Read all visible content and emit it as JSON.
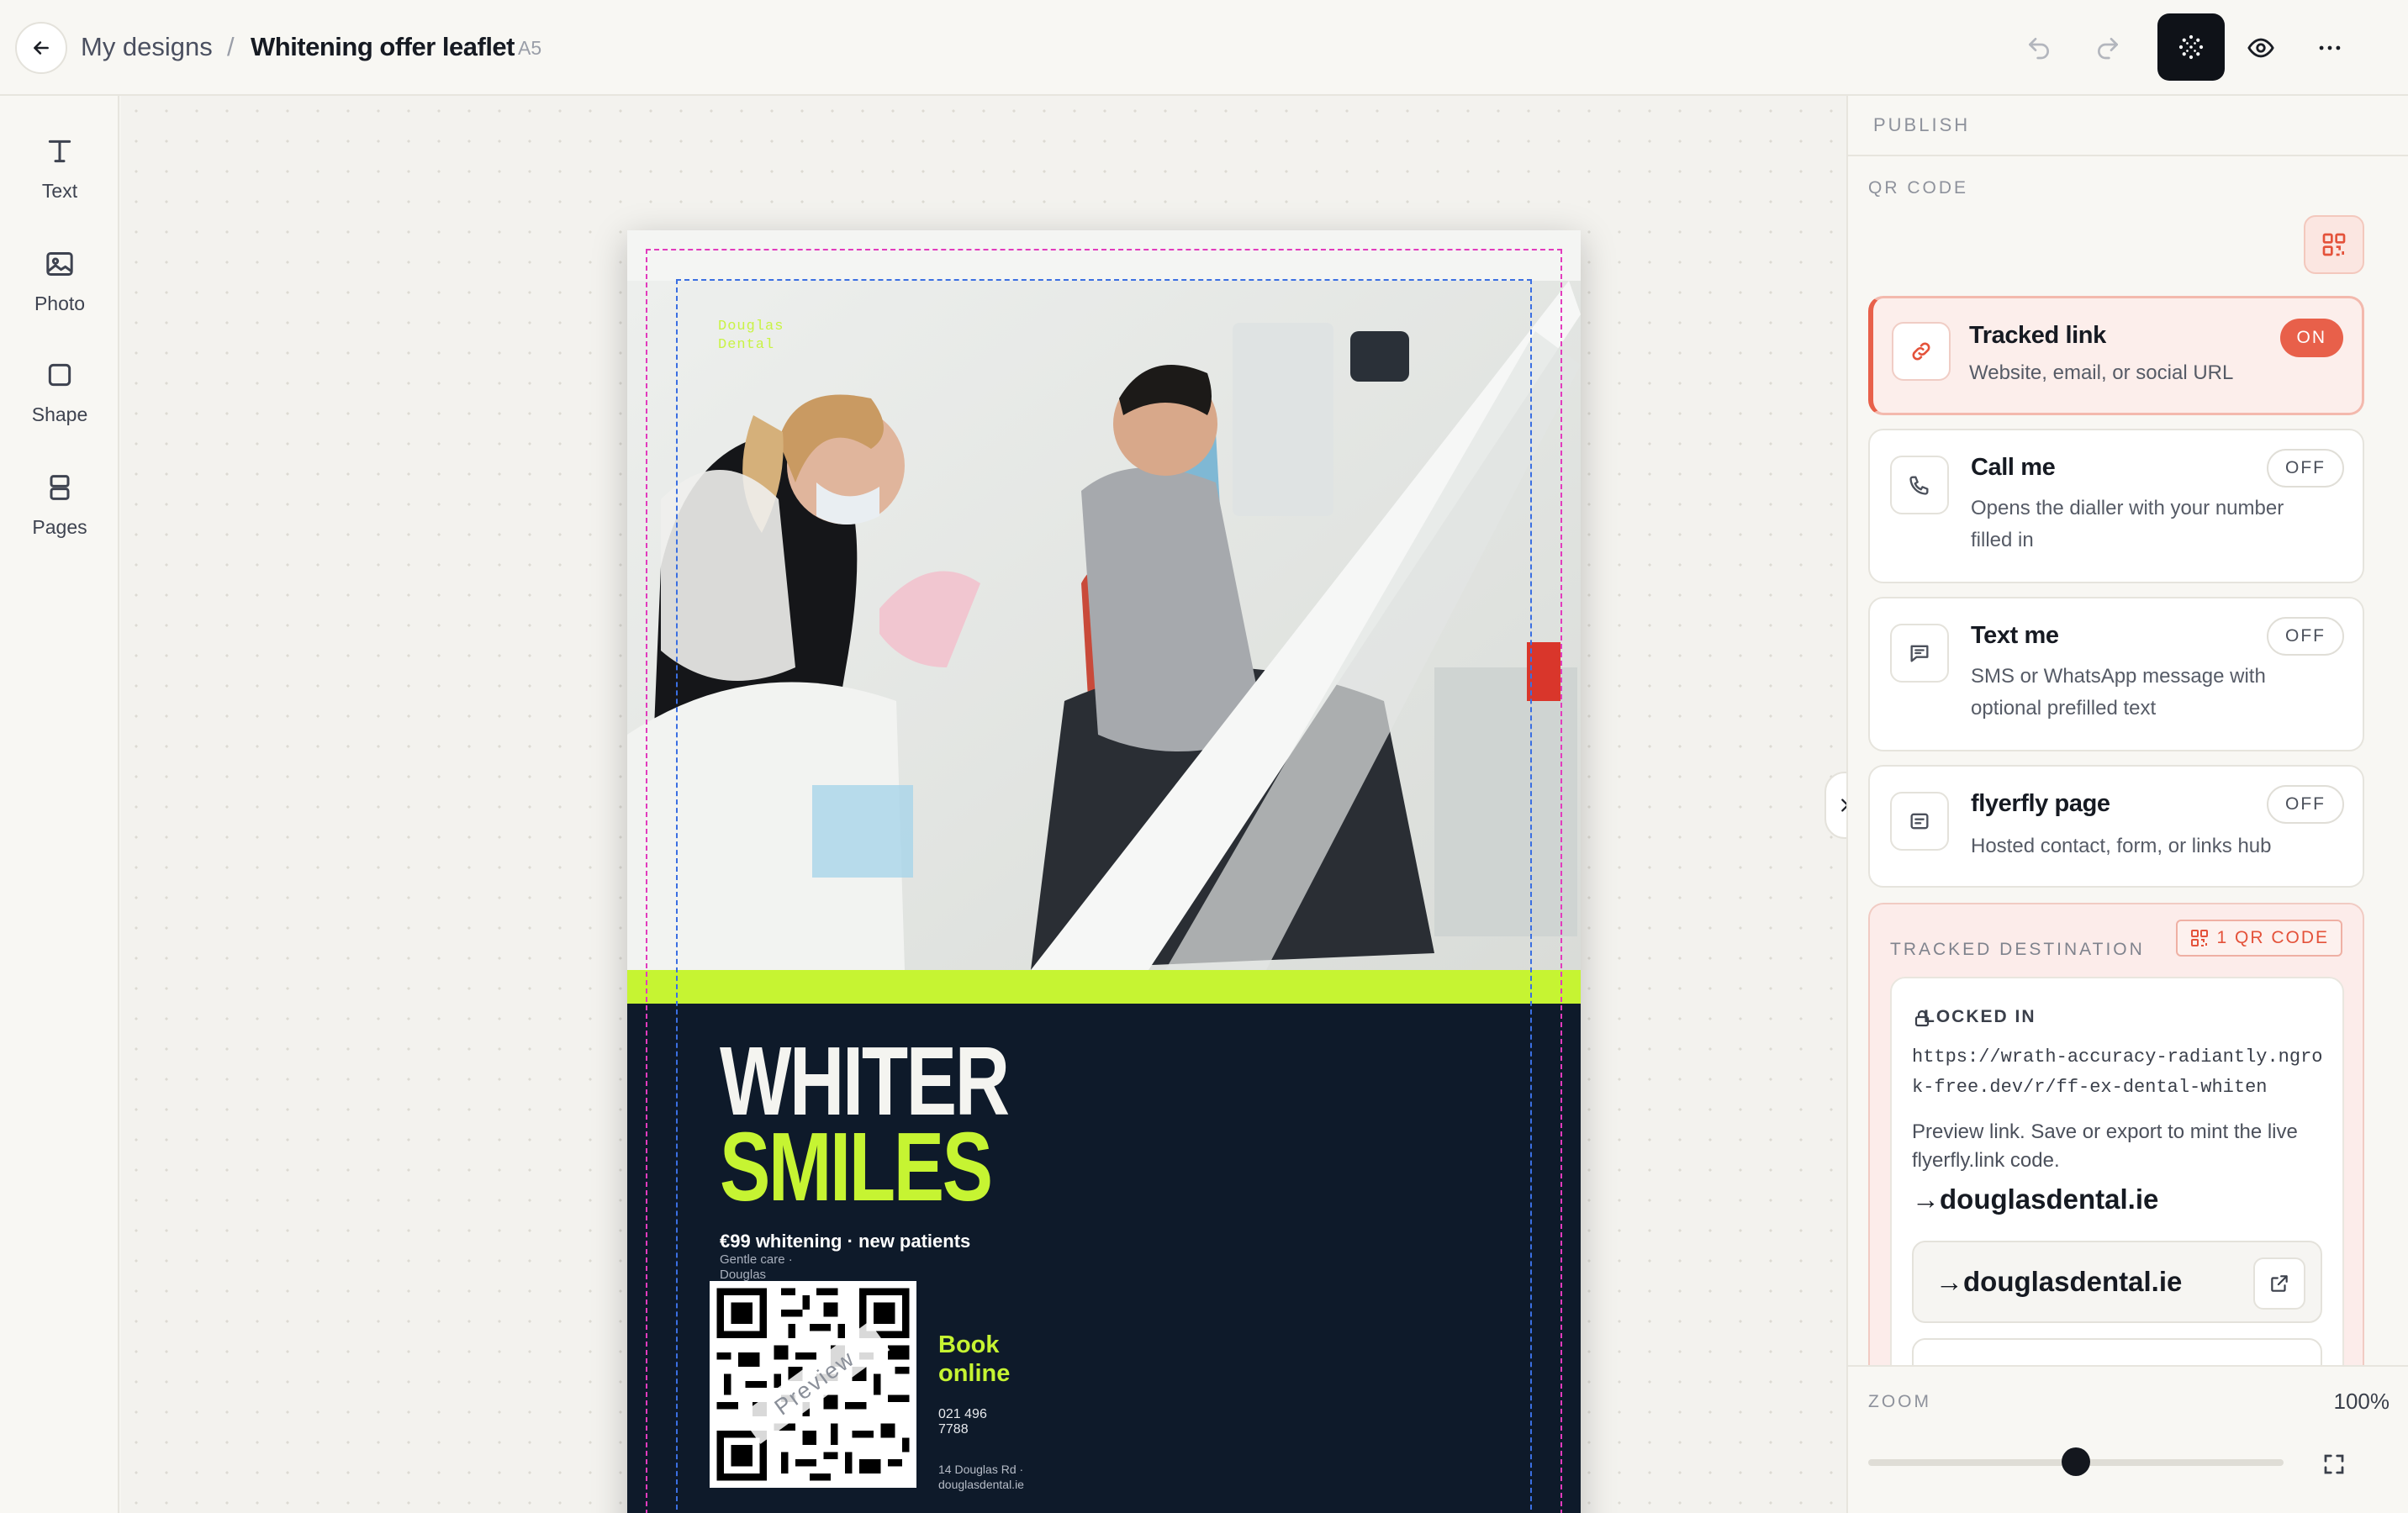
{
  "header": {
    "breadcrumb_root": "My designs",
    "breadcrumb_sep": "/",
    "design_title": "Whitening offer leaflet",
    "design_size": "A5"
  },
  "tools": [
    {
      "label": "Text",
      "icon": "text-icon"
    },
    {
      "label": "Photo",
      "icon": "photo-icon"
    },
    {
      "label": "Shape",
      "icon": "shape-icon"
    },
    {
      "label": "Pages",
      "icon": "pages-icon"
    }
  ],
  "leaflet": {
    "brand_line1": "Douglas",
    "brand_line2": "Dental",
    "headline_1": "WHITER",
    "headline_2": "SMILES",
    "offer": "€99 whitening · new patients",
    "tagline_1": "Gentle care ·",
    "tagline_2": "Douglas",
    "qr_overlay": "Preview",
    "cta_line1": "Book",
    "cta_line2": "online",
    "phone_line1": "021 496",
    "phone_line2": "7788",
    "address_line1": "14 Douglas Rd ·",
    "address_line2": "douglasdental.ie"
  },
  "panel": {
    "section_title": "PUBLISH",
    "qr_section": "QR CODE",
    "options": [
      {
        "title": "Tracked link",
        "desc": "Website, email, or social URL",
        "state": "ON",
        "icon": "link-icon"
      },
      {
        "title": "Call me",
        "desc": "Opens the dialler with your number filled in",
        "state": "OFF",
        "icon": "phone-icon"
      },
      {
        "title": "Text me",
        "desc": "SMS or WhatsApp message with optional prefilled text",
        "state": "OFF",
        "icon": "message-icon"
      },
      {
        "title": "flyerfly page",
        "desc": "Hosted contact, form, or links hub",
        "state": "OFF",
        "icon": "page-icon"
      }
    ],
    "destination": {
      "label": "TRACKED DESTINATION",
      "badge": "1 QR CODE",
      "locked_label": "LOCKED IN",
      "url": "https://wrath-accuracy-radiantly.ngrok-free.dev/r/ff-ex-dental-whiten",
      "note": "Preview link. Save or export to mint the live flyerfly.link code.",
      "domain": "→douglasdental.ie",
      "link_text": "→douglasdental.ie"
    },
    "zoom": {
      "label": "ZOOM",
      "value": "100%",
      "level": 0.5
    }
  },
  "colors": {
    "accent": "#e8604a",
    "lime": "#c6f432",
    "navy": "#0e1a2a"
  }
}
